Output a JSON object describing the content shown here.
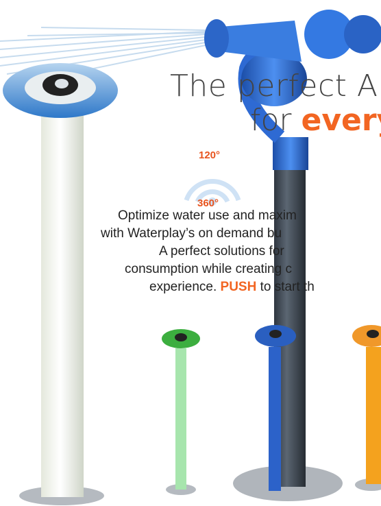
{
  "headline": {
    "line1": "The perfect A",
    "line2_prefix": "for ",
    "line2_emphasis": "every"
  },
  "spray_angles": {
    "narrow": "120°",
    "wide": "360°"
  },
  "description": {
    "line1": "Optimize water use and maxim",
    "line2": "with Waterplay’s on demand bu",
    "line3": "A perfect solutions for",
    "line4": "consumption while creating c",
    "line5_prefix": "experience. ",
    "line5_keyword": "PUSH",
    "line5_suffix": " to start th"
  },
  "colors": {
    "accent_orange": "#f26522",
    "headline_gray": "#444444",
    "nozzle_blue": "#2f6fd6",
    "post_gray": "#3c4551",
    "post_white": "#f3f5ee",
    "post_green": "#9fe0a6",
    "post_blue": "#2c62c9",
    "post_orange": "#f4a21e"
  }
}
